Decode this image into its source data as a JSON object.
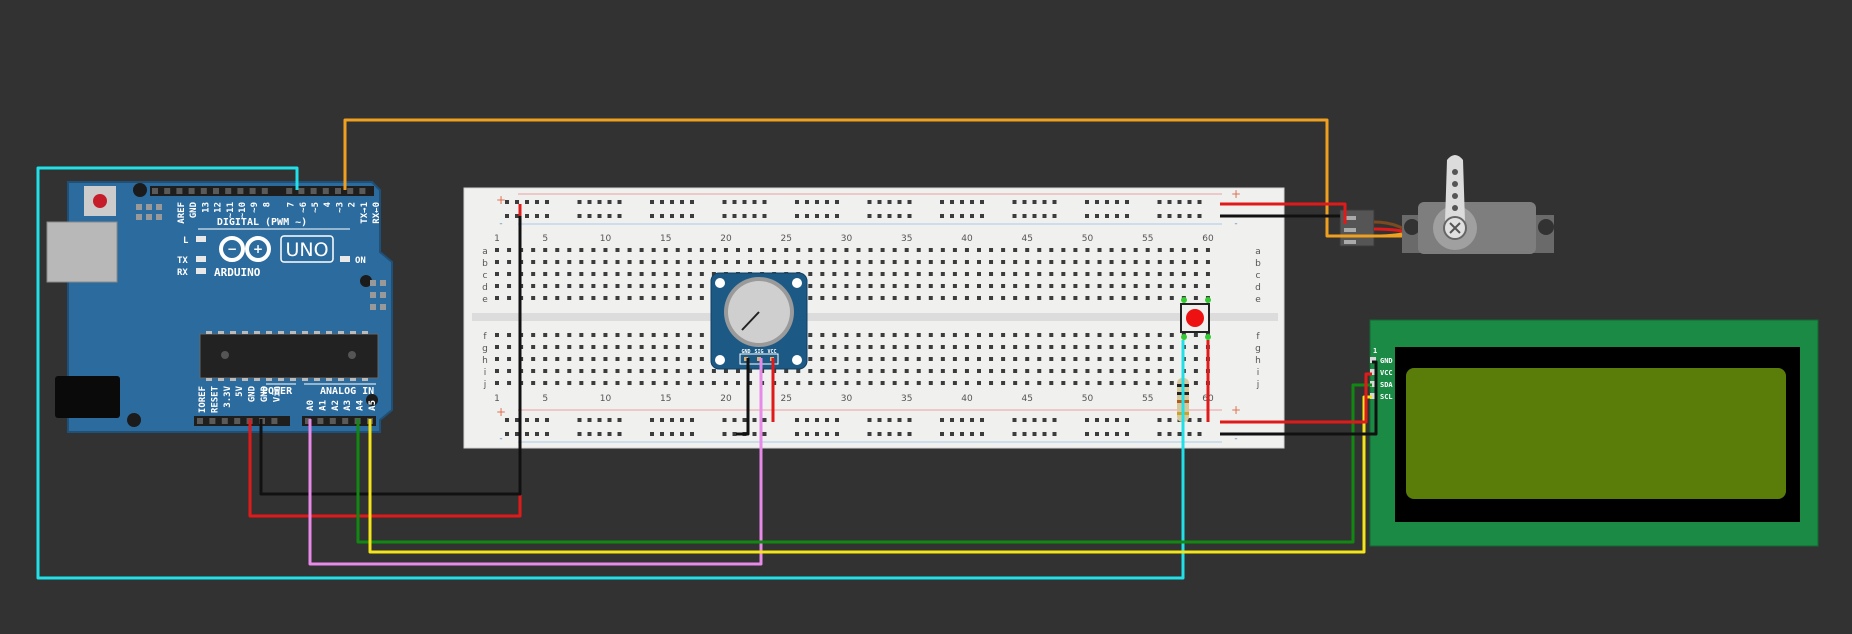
{
  "arduino": {
    "model": "UNO",
    "brand": "ARDUINO",
    "digital_header": "DIGITAL (PWM ~)",
    "digital_pins": [
      "AREF",
      "GND",
      "13",
      "12",
      "~11",
      "~10",
      "~9",
      "8",
      "7",
      "~6",
      "~5",
      "4",
      "~3",
      "2",
      "TX→1",
      "RX←0"
    ],
    "power_label": "POWER",
    "power_pins": [
      "IOREF",
      "RESET",
      "3.3V",
      "5V",
      "GND",
      "GND",
      "Vin"
    ],
    "analog_label": "ANALOG IN",
    "analog_pins": [
      "A0",
      "A1",
      "A2",
      "A3",
      "A4",
      "A5"
    ],
    "led_l": "L",
    "led_tx": "TX",
    "led_rx": "RX",
    "led_on": "ON"
  },
  "breadboard": {
    "column_numbers": [
      "1",
      "5",
      "10",
      "15",
      "20",
      "25",
      "30",
      "35",
      "40",
      "45",
      "50",
      "55",
      "60"
    ],
    "rows_top": [
      "a",
      "b",
      "c",
      "d",
      "e"
    ],
    "rows_bottom": [
      "f",
      "g",
      "h",
      "i",
      "j"
    ],
    "rail_plus": "+",
    "rail_minus": "-"
  },
  "potentiometer": {
    "pins": [
      "GND",
      "SIG",
      "VCC"
    ]
  },
  "lcd": {
    "pin1_marker": "1",
    "pins": [
      "GND",
      "VCC",
      "SDA",
      "SCL"
    ]
  },
  "colors": {
    "background": "#323232",
    "arduino_board": "#2c6b9e",
    "breadboard": "#f0f0ef",
    "lcd_pcb": "#1a8a45",
    "lcd_screen": "#5a7d0a",
    "pot_board": "#1c5a85",
    "wire_orange": "#f0a020",
    "wire_cyan": "#22e0e8",
    "wire_red": "#e01a1a",
    "wire_black": "#111111",
    "wire_pink": "#e88ae8",
    "wire_green": "#118811",
    "wire_yellow": "#f4e41a"
  }
}
